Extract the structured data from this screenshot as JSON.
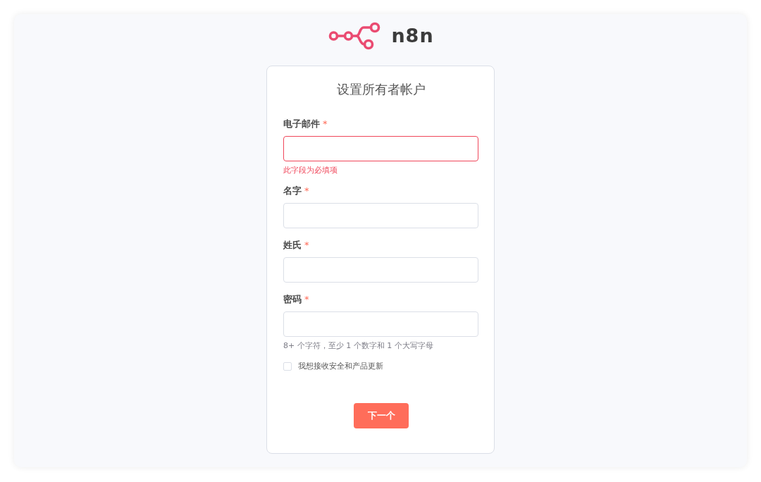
{
  "logo": {
    "text": "n8n"
  },
  "form": {
    "title": "设置所有者帐户",
    "fields": [
      {
        "label": "电子邮件",
        "required_mark": "*",
        "invalid": true,
        "error": "此字段为必填项"
      },
      {
        "label": "名字",
        "required_mark": "*",
        "invalid": false
      },
      {
        "label": "姓氏",
        "required_mark": "*",
        "invalid": false
      },
      {
        "label": "密码",
        "required_mark": "*",
        "invalid": false,
        "hint": "8+ 个字符，至少 1 个数字和 1 个大写字母"
      }
    ],
    "checkbox": {
      "label": "我想接收安全和产品更新",
      "checked": false
    },
    "submit": {
      "label": "下一个"
    }
  }
}
